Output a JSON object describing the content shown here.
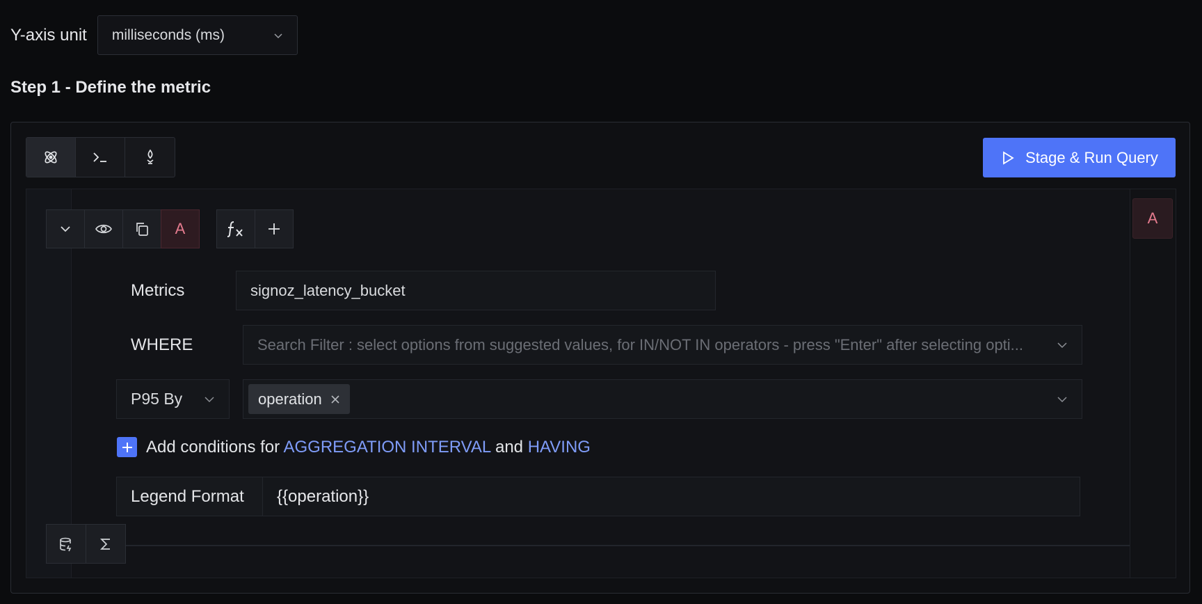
{
  "yaxis": {
    "label": "Y-axis unit",
    "value": "milliseconds (ms)"
  },
  "step_title": "Step 1 - Define the metric",
  "mode_tabs": [
    {
      "icon": "query-builder-icon"
    },
    {
      "icon": "terminal-icon"
    },
    {
      "icon": "promql-icon"
    }
  ],
  "run_button": {
    "label": "Stage & Run Query"
  },
  "query": {
    "name": "A",
    "right_badge": "A",
    "metrics": {
      "label": "Metrics",
      "value": "signoz_latency_bucket"
    },
    "where": {
      "label": "WHERE",
      "placeholder": "Search Filter : select options from suggested values, for IN/NOT IN operators - press \"Enter\" after selecting opti..."
    },
    "group_by": {
      "aggregation": "P95 By",
      "tags": [
        "operation"
      ]
    },
    "conditions": {
      "prefix": "Add conditions for",
      "link1": "AGGREGATION INTERVAL",
      "middle": "and",
      "link2": "HAVING"
    },
    "legend": {
      "label": "Legend Format",
      "value": "{{operation}}"
    }
  },
  "colors": {
    "accent": "#4e74f8",
    "badge_text": "#e57b8e",
    "link": "#7f9cf8"
  }
}
